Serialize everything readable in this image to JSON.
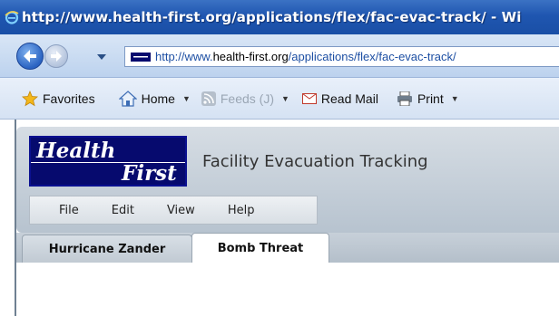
{
  "browser": {
    "title": "http://www.health-first.org/applications/flex/fac-evac-track/ - Wi",
    "address": {
      "prefix": "http://www.",
      "domain": "health-first.org",
      "path": "/applications/flex/fac-evac-track/"
    }
  },
  "commandbar": {
    "favorites": "Favorites",
    "home": "Home",
    "feeds": "Feeds (J)",
    "read_mail": "Read Mail",
    "print": "Print"
  },
  "app": {
    "logo_line1": "Health",
    "logo_line2": "First",
    "title": "Facility Evacuation Tracking",
    "menu": [
      "File",
      "Edit",
      "View",
      "Help"
    ],
    "tabs": [
      "Hurricane Zander",
      "Bomb Threat"
    ],
    "active_tab": "Bomb Threat"
  },
  "colors": {
    "titlebar": "#1f56b0",
    "logo_bg": "#060a6e",
    "nav_bg": "#bcd2ee"
  }
}
